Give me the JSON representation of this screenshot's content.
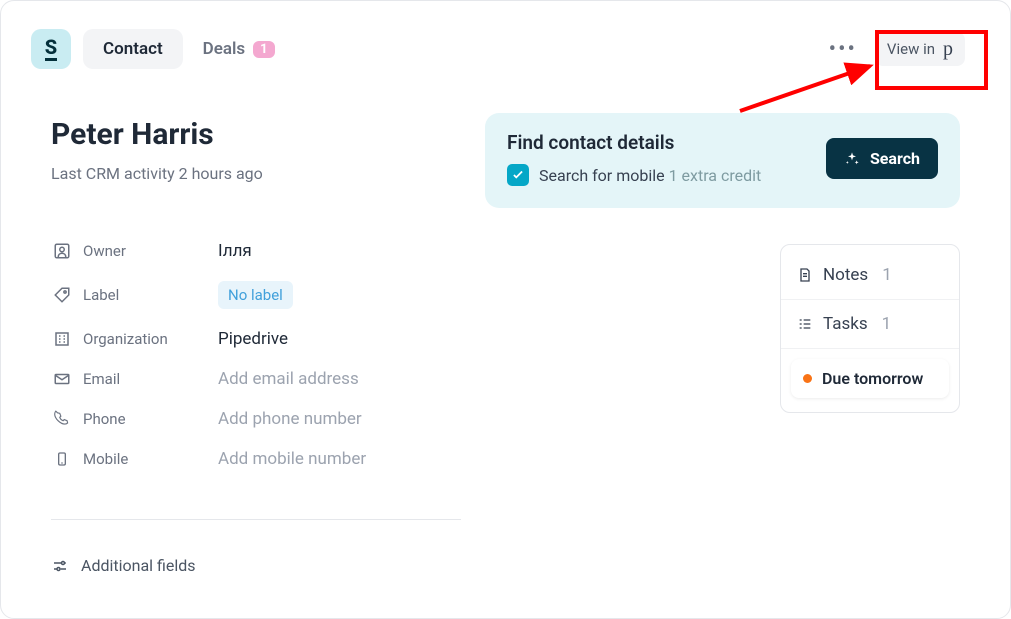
{
  "topbar": {
    "tabs": {
      "contact": "Contact",
      "deals": "Deals",
      "deals_badge": "1"
    },
    "view_in_label": "View in"
  },
  "contact": {
    "name": "Peter Harris",
    "activity_prefix": "Last CRM activity",
    "activity_time": "2 hours ago"
  },
  "fields": {
    "owner": {
      "label": "Owner",
      "value": "Ілля"
    },
    "label": {
      "label": "Label",
      "value": "No label"
    },
    "org": {
      "label": "Organization",
      "value": "Pipedrive"
    },
    "email": {
      "label": "Email",
      "placeholder": "Add email address"
    },
    "phone": {
      "label": "Phone",
      "placeholder": "Add phone number"
    },
    "mobile": {
      "label": "Mobile",
      "placeholder": "Add mobile number"
    }
  },
  "additional_fields_label": "Additional fields",
  "find": {
    "title": "Find contact details",
    "checkbox_label": "Search for mobile",
    "credit_text": "1 extra credit",
    "search_button": "Search"
  },
  "side": {
    "notes_label": "Notes",
    "notes_count": "1",
    "tasks_label": "Tasks",
    "tasks_count": "1",
    "due_label": "Due tomorrow"
  }
}
